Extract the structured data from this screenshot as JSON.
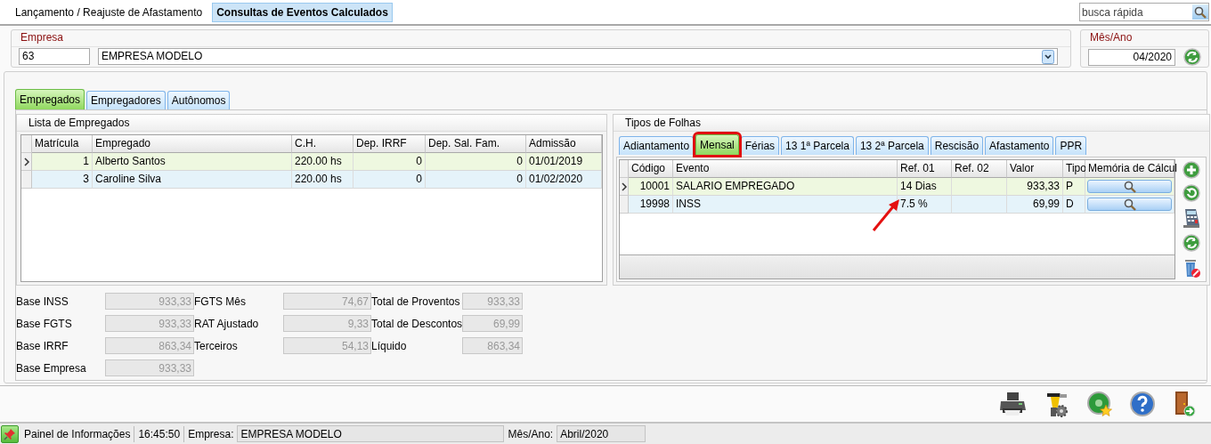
{
  "top_tabs": [
    {
      "label": "Lançamento / Reajuste de Afastamento",
      "selected": false
    },
    {
      "label": "Consultas de Eventos Calculados",
      "selected": true
    }
  ],
  "search": {
    "placeholder": "busca rápida"
  },
  "empresa": {
    "label": "Empresa",
    "code": "63",
    "name": "EMPRESA MODELO"
  },
  "mes_ano": {
    "label": "Mês/Ano",
    "value": "04/2020"
  },
  "main_tabs": [
    {
      "label": "Empregados",
      "selected": true
    },
    {
      "label": "Empregadores",
      "selected": false
    },
    {
      "label": "Autônomos",
      "selected": false
    }
  ],
  "employees": {
    "title": "Lista de Empregados",
    "columns": [
      "Matrícula",
      "Empregado",
      "C.H.",
      "Dep. IRRF",
      "Dep. Sal. Fam.",
      "Admissão"
    ],
    "rows": [
      {
        "selected": true,
        "cells": [
          "1",
          "Alberto Santos",
          "220.00 hs",
          "0",
          "0",
          "01/01/2019"
        ]
      },
      {
        "selected": false,
        "cells": [
          "3",
          "Caroline Silva",
          "220.00 hs",
          "0",
          "0",
          "01/02/2020"
        ]
      }
    ]
  },
  "folhas": {
    "title": "Tipos de Folhas",
    "tabs": [
      {
        "label": "Adiantamento",
        "selected": false,
        "highlighted": false
      },
      {
        "label": "Mensal",
        "selected": true,
        "highlighted": true
      },
      {
        "label": "Férias",
        "selected": false,
        "highlighted": false
      },
      {
        "label": "13 1ª Parcela",
        "selected": false,
        "highlighted": false
      },
      {
        "label": "13 2ª Parcela",
        "selected": false,
        "highlighted": false
      },
      {
        "label": "Rescisão",
        "selected": false,
        "highlighted": false
      },
      {
        "label": "Afastamento",
        "selected": false,
        "highlighted": false
      },
      {
        "label": "PPR",
        "selected": false,
        "highlighted": false
      }
    ],
    "columns": [
      "Código",
      "Evento",
      "Ref. 01",
      "Ref. 02",
      "Valor",
      "Tipo",
      "Memória de Cálcul"
    ],
    "rows": [
      {
        "selected": true,
        "cells": [
          "10001",
          "SALARIO EMPREGADO",
          "14 Dias",
          "",
          "933,33",
          "P"
        ]
      },
      {
        "selected": false,
        "cells": [
          "19998",
          "INSS",
          "7.5 %",
          "",
          "69,99",
          "D"
        ]
      }
    ]
  },
  "totals": [
    [
      {
        "label": "Base INSS",
        "value": "933,33",
        "disabled": true
      },
      {
        "label": "Base FGTS",
        "value": "933,33",
        "disabled": true
      },
      {
        "label": "Base IRRF",
        "value": "863,34",
        "disabled": true
      },
      {
        "label": "Base Empresa",
        "value": "933,33",
        "disabled": true
      }
    ],
    [
      {
        "label": "FGTS Mês",
        "value": "74,67",
        "disabled": true
      },
      {
        "label": "RAT Ajustado",
        "value": "9,33",
        "disabled": true
      },
      {
        "label": "Terceiros",
        "value": "54,13",
        "disabled": true
      }
    ],
    [
      {
        "label": "Total de Proventos",
        "value": "933,33",
        "disabled": true
      },
      {
        "label": "Total de Descontos",
        "value": "69,99",
        "disabled": true
      },
      {
        "label": "Líquido",
        "value": "863,34",
        "disabled": true
      }
    ]
  ],
  "status_bar": {
    "panel": "Painel de Informações",
    "time": "16:45:50",
    "empresa_label": "Empresa:",
    "empresa": "EMPRESA MODELO",
    "mes_label": "Mês/Ano:",
    "mes": "Abril/2020"
  }
}
